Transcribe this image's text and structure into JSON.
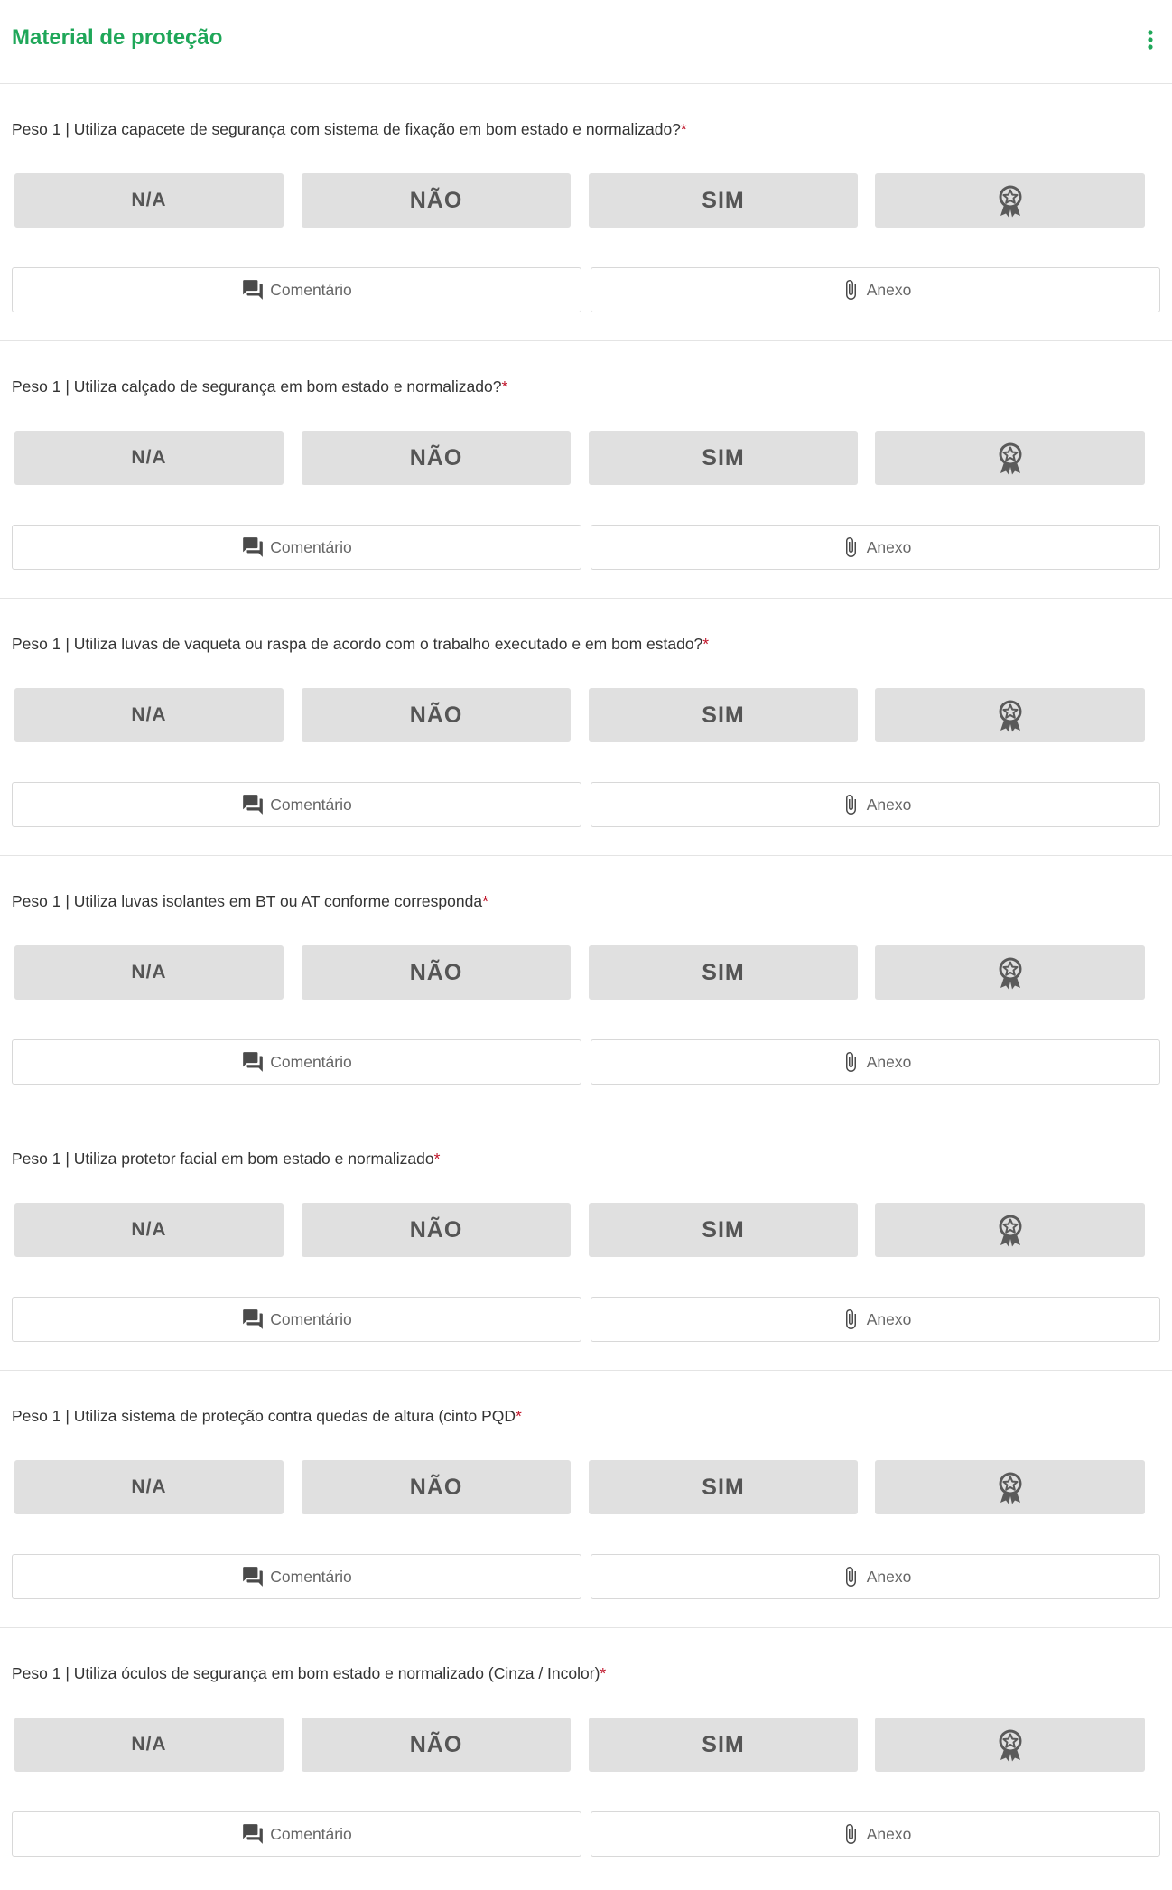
{
  "header": {
    "title": "Material de proteção",
    "menu_icon": "more-vertical-icon"
  },
  "colors": {
    "accent": "#1fa759",
    "required": "#c0152a",
    "option_bg": "#e0e0e0",
    "option_text": "#555555"
  },
  "questions": [
    {
      "text": "Peso 1 | Utiliza capacete de segurança com sistema de fixação em bom estado e normalizado?",
      "required_mark": "*",
      "options": [
        "N/A",
        "NÃO",
        "SIM"
      ],
      "badge_icon": "award-badge-icon",
      "comment_label": "Comentário",
      "attach_label": "Anexo"
    },
    {
      "text": "Peso 1 | Utiliza calçado de segurança em bom estado e normalizado?",
      "required_mark": "*",
      "options": [
        "N/A",
        "NÃO",
        "SIM"
      ],
      "badge_icon": "award-badge-icon",
      "comment_label": "Comentário",
      "attach_label": "Anexo"
    },
    {
      "text": "Peso 1 | Utiliza luvas de vaqueta ou raspa de acordo com o trabalho executado e em bom estado?",
      "required_mark": "*",
      "options": [
        "N/A",
        "NÃO",
        "SIM"
      ],
      "badge_icon": "award-badge-icon",
      "comment_label": "Comentário",
      "attach_label": "Anexo"
    },
    {
      "text": "Peso 1 | Utiliza luvas isolantes em BT ou AT conforme corresponda",
      "required_mark": "*",
      "options": [
        "N/A",
        "NÃO",
        "SIM"
      ],
      "badge_icon": "award-badge-icon",
      "comment_label": "Comentário",
      "attach_label": "Anexo"
    },
    {
      "text": "Peso 1 | Utiliza protetor facial em bom estado e normalizado",
      "required_mark": "*",
      "options": [
        "N/A",
        "NÃO",
        "SIM"
      ],
      "badge_icon": "award-badge-icon",
      "comment_label": "Comentário",
      "attach_label": "Anexo"
    },
    {
      "text": "Peso 1 | Utiliza sistema de proteção contra quedas de altura (cinto PQD",
      "required_mark": "*",
      "options": [
        "N/A",
        "NÃO",
        "SIM"
      ],
      "badge_icon": "award-badge-icon",
      "comment_label": "Comentário",
      "attach_label": "Anexo"
    },
    {
      "text": "Peso 1 | Utiliza óculos de segurança em bom estado e normalizado (Cinza / Incolor)",
      "required_mark": "*",
      "options": [
        "N/A",
        "NÃO",
        "SIM"
      ],
      "badge_icon": "award-badge-icon",
      "comment_label": "Comentário",
      "attach_label": "Anexo"
    }
  ]
}
